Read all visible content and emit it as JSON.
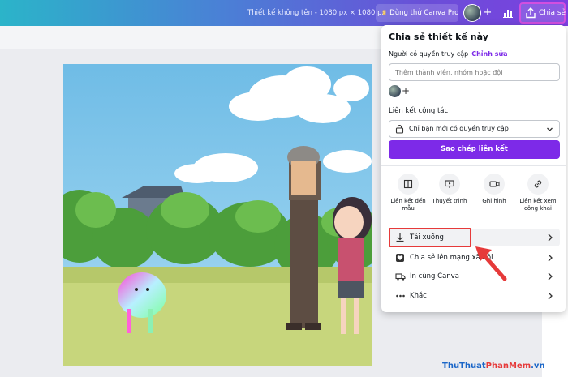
{
  "topbar": {
    "doc_title": "Thiết kế không tên - 1080 px × 1080 px",
    "try_pro": "Dùng thử Canva Pro",
    "share": "Chia sẻ"
  },
  "panel": {
    "title": "Chia sẻ thiết kế này",
    "access_label": "Người có quyền truy cập",
    "access_edit": "Chỉnh sửa",
    "invite_placeholder": "Thêm thành viên, nhóm hoặc đội",
    "collab_label": "Liên kết cộng tác",
    "access_option": "Chỉ bạn mới có quyền truy cập",
    "copy_link": "Sao chép liên kết",
    "options": [
      {
        "label": "Liên kết đến mẫu",
        "icon": "template-icon"
      },
      {
        "label": "Thuyết trình",
        "icon": "presentation-icon"
      },
      {
        "label": "Ghi hình",
        "icon": "video-camera-icon"
      },
      {
        "label": "Liên kết xem công khai",
        "icon": "link-icon"
      }
    ],
    "rows": [
      {
        "label": "Tải xuống",
        "icon": "download-icon"
      },
      {
        "label": "Chia sẻ lên mạng xã hội",
        "icon": "heart-icon"
      },
      {
        "label": "In cùng Canva",
        "icon": "truck-icon"
      },
      {
        "label": "Khác",
        "icon": "more-icon"
      }
    ]
  },
  "watermark": {
    "a": "ThuThuat",
    "b": "PhanMem",
    "c": ".vn"
  },
  "colors": {
    "accent": "#7d2ae8",
    "highlight": "#e63a3a"
  }
}
